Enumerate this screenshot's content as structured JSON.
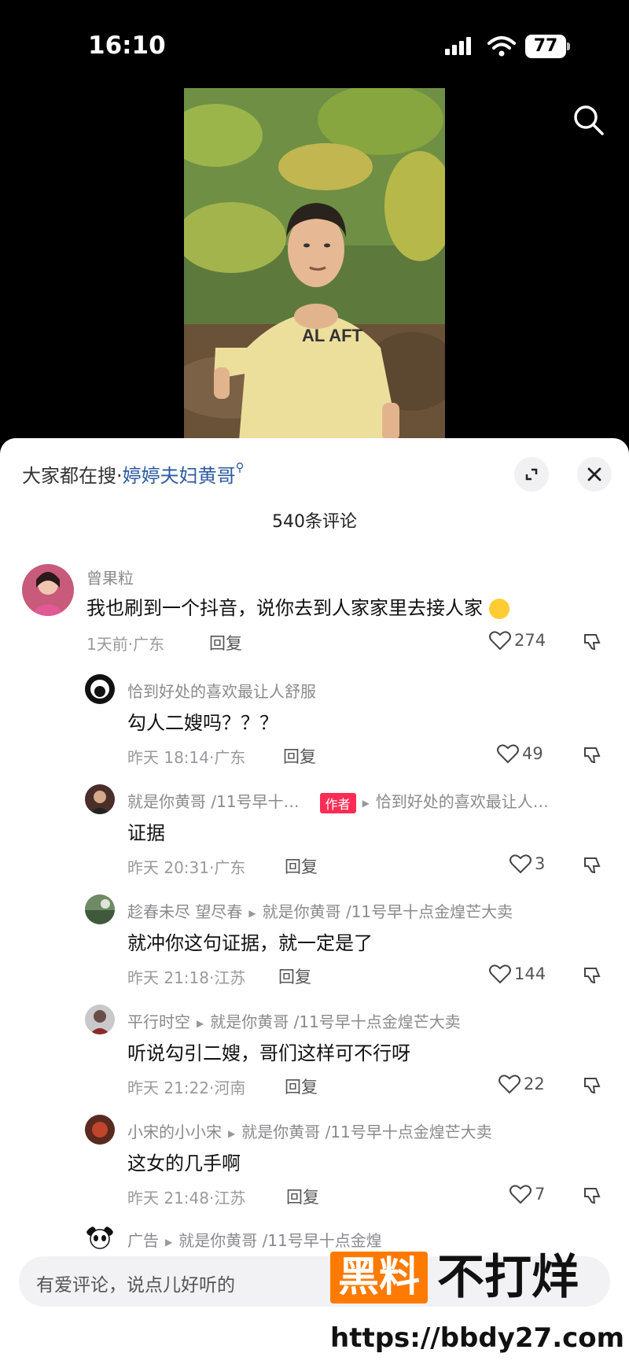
{
  "status": {
    "time": "16:10",
    "battery": "77"
  },
  "panel": {
    "hot_label": "大家都在搜·",
    "hot_term": "婷婷夫妇黄哥",
    "count": "540条评论",
    "input_placeholder": "有爱评论，说点儿好听的"
  },
  "comments": [
    {
      "name": "曾果粒",
      "text": "我也刷到一个抖音，说你去到人家家里去接人家",
      "time": "1天前·广东",
      "reply": "回复",
      "likes": "274"
    },
    {
      "name": "恰到好处的喜欢最让人舒服",
      "text": "勾人二嫂吗？？？",
      "time": "昨天 18:14·广东",
      "reply": "回复",
      "likes": "49"
    },
    {
      "name": "就是你黄哥 /11号早十…",
      "badge": "作者",
      "reply_to": "恰到好处的喜欢最让人…",
      "text": "证据",
      "time": "昨天 20:31·广东",
      "reply": "回复",
      "likes": "3"
    },
    {
      "name": "趁春未尽 望尽春",
      "reply_to": "就是你黄哥 /11号早十点金煌芒大卖",
      "text": "就冲你这句证据，就一定是了",
      "time": "昨天 21:18·江苏",
      "reply": "回复",
      "likes": "144"
    },
    {
      "name": "平行时空",
      "reply_to": "就是你黄哥 /11号早十点金煌芒大卖",
      "text": "听说勾引二嫂，哥们这样可不行呀",
      "time": "昨天 21:22·河南",
      "reply": "回复",
      "likes": "22"
    },
    {
      "name": "小宋的小小宋",
      "reply_to": "就是你黄哥 /11号早十点金煌芒大卖",
      "text": "这女的几手啊",
      "time": "昨天 21:48·江苏",
      "reply": "回复",
      "likes": "7"
    },
    {
      "name": "广告",
      "reply_to": "就是你黄哥 /11号早十点金煌"
    }
  ],
  "watermark": {
    "logo": "黑料",
    "logo_rest": "不打烊",
    "url": "https://bbdy27.com"
  },
  "colors": {
    "accent": "#fe2c55",
    "link": "#2c5aa0",
    "watermark": "#ff7a00"
  }
}
